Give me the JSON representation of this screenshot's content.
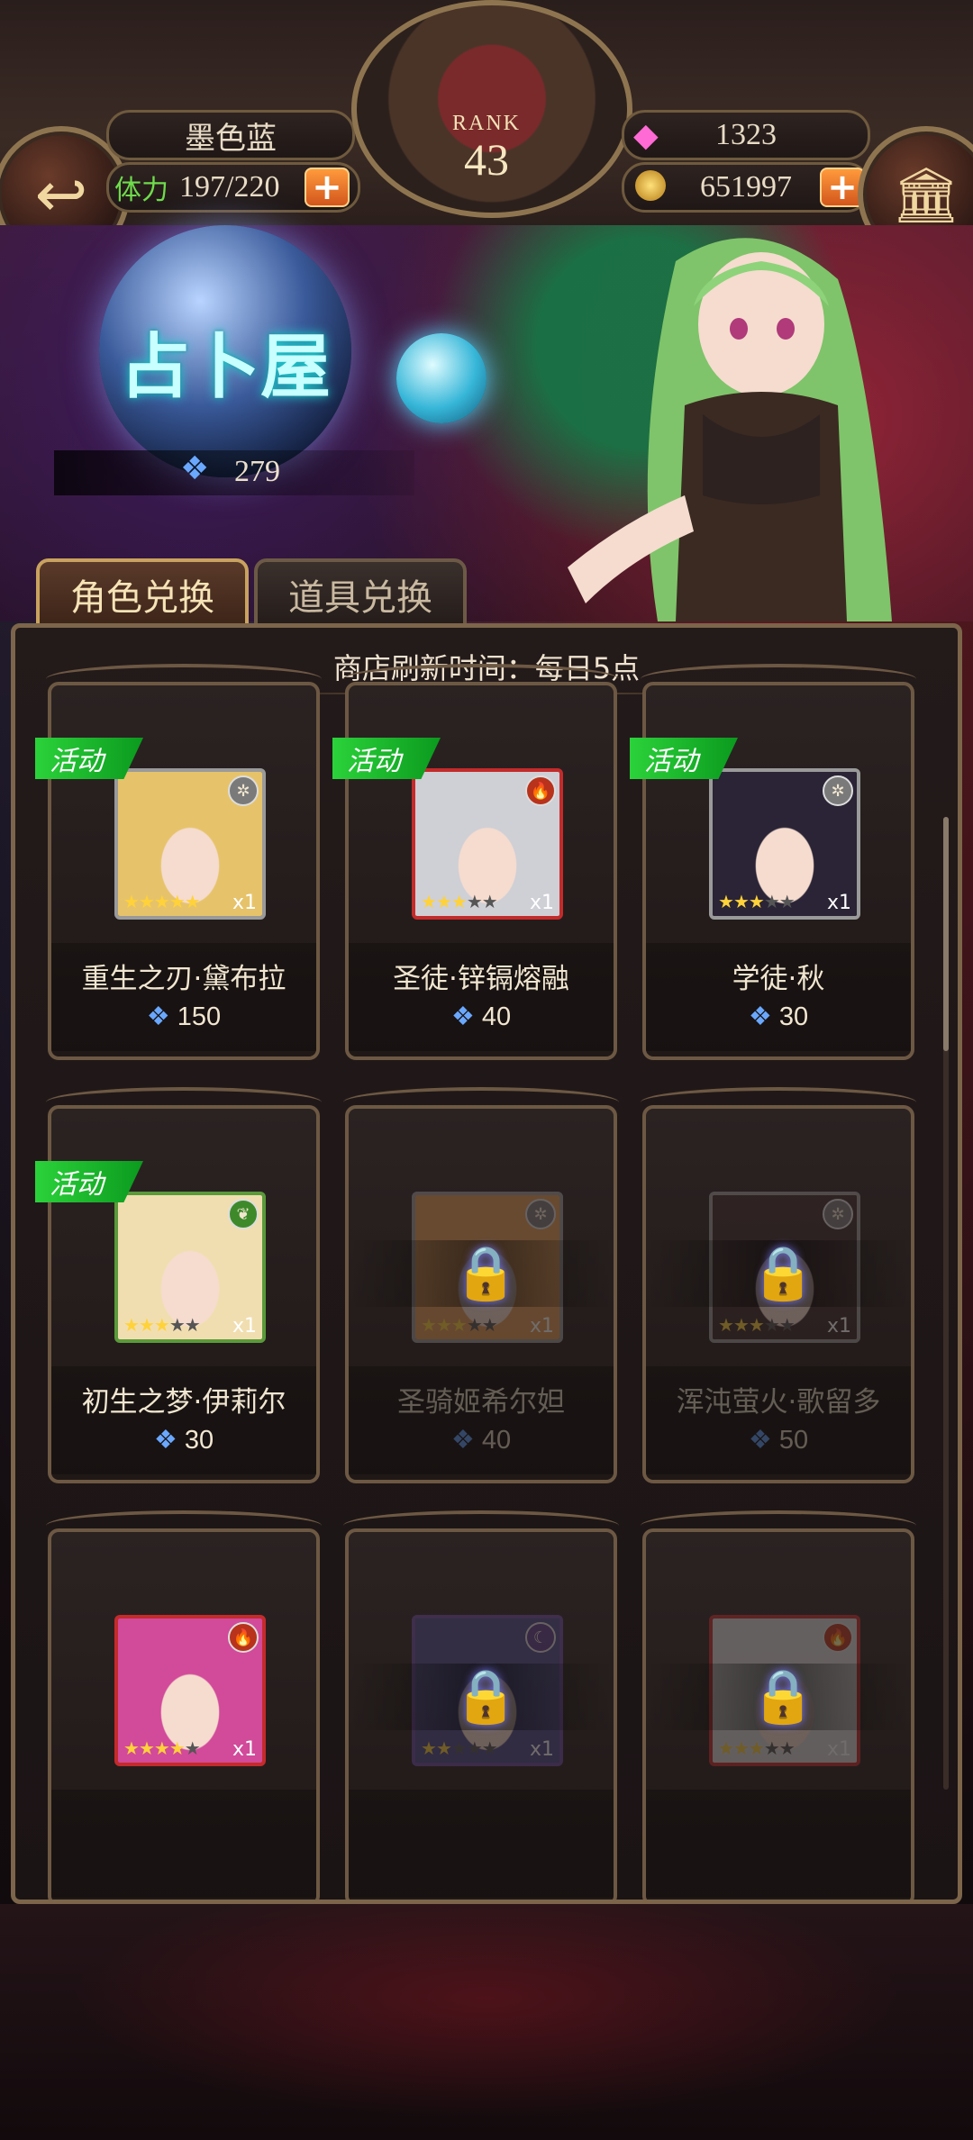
{
  "header": {
    "player_name": "墨色蓝",
    "stamina_label": "体力",
    "stamina_value": "197/220",
    "rank_label": "RANK",
    "rank_value": "43",
    "gems": "1323",
    "gold": "651997",
    "plus_symbol": "+"
  },
  "banner": {
    "shop_title": "占卜屋",
    "currency_amount": "279"
  },
  "tabs": [
    {
      "label": "角色兑换",
      "active": true
    },
    {
      "label": "道具兑换",
      "active": false
    }
  ],
  "shop": {
    "refresh_text": "商店刷新时间：每日5点",
    "event_tag": "活动",
    "items": [
      {
        "name": "重生之刃·黛布拉",
        "price": "150",
        "stars": 5,
        "count": "x1",
        "event": true,
        "locked": false,
        "element": "light-icon",
        "hair": "#e6c36a",
        "frame": "#9a9a9a"
      },
      {
        "name": "圣徒·锌镉熔融",
        "price": "40",
        "stars": 3,
        "count": "x1",
        "event": true,
        "locked": false,
        "element": "fire-icon",
        "hair": "#cfcfd6",
        "frame": "#c42b2b"
      },
      {
        "name": "学徒·秋",
        "price": "30",
        "stars": 3,
        "count": "x1",
        "event": true,
        "locked": false,
        "element": "light-icon",
        "hair": "#2a2436",
        "frame": "#9a9a9a"
      },
      {
        "name": "初生之梦·伊莉尔",
        "price": "30",
        "stars": 3,
        "count": "x1",
        "event": true,
        "locked": false,
        "element": "leaf-icon",
        "hair": "#f1deb0",
        "frame": "#5a9a3a"
      },
      {
        "name": "圣骑姬希尔妲",
        "price": "40",
        "stars": 3,
        "count": "x1",
        "event": false,
        "locked": true,
        "element": "light-icon",
        "hair": "#e09a55",
        "frame": "#9a9a9a"
      },
      {
        "name": "浑沌萤火·歌留多",
        "price": "50",
        "stars": 3,
        "count": "x1",
        "event": false,
        "locked": true,
        "element": "light-icon",
        "hair": "#3a2a2a",
        "frame": "#9a9a9a"
      },
      {
        "name": "",
        "price": "",
        "stars": 4,
        "count": "x1",
        "event": false,
        "locked": false,
        "element": "fire-icon",
        "hair": "#d24a9a",
        "frame": "#c42b2b"
      },
      {
        "name": "",
        "price": "",
        "stars": 2,
        "count": "x1",
        "event": false,
        "locked": true,
        "element": "moon-icon",
        "hair": "#4a4a8a",
        "frame": "#6a4aa0"
      },
      {
        "name": "",
        "price": "",
        "stars": 3,
        "count": "x1",
        "event": false,
        "locked": true,
        "element": "fire-icon",
        "hair": "#d8d8d8",
        "frame": "#c42b2b"
      }
    ]
  }
}
